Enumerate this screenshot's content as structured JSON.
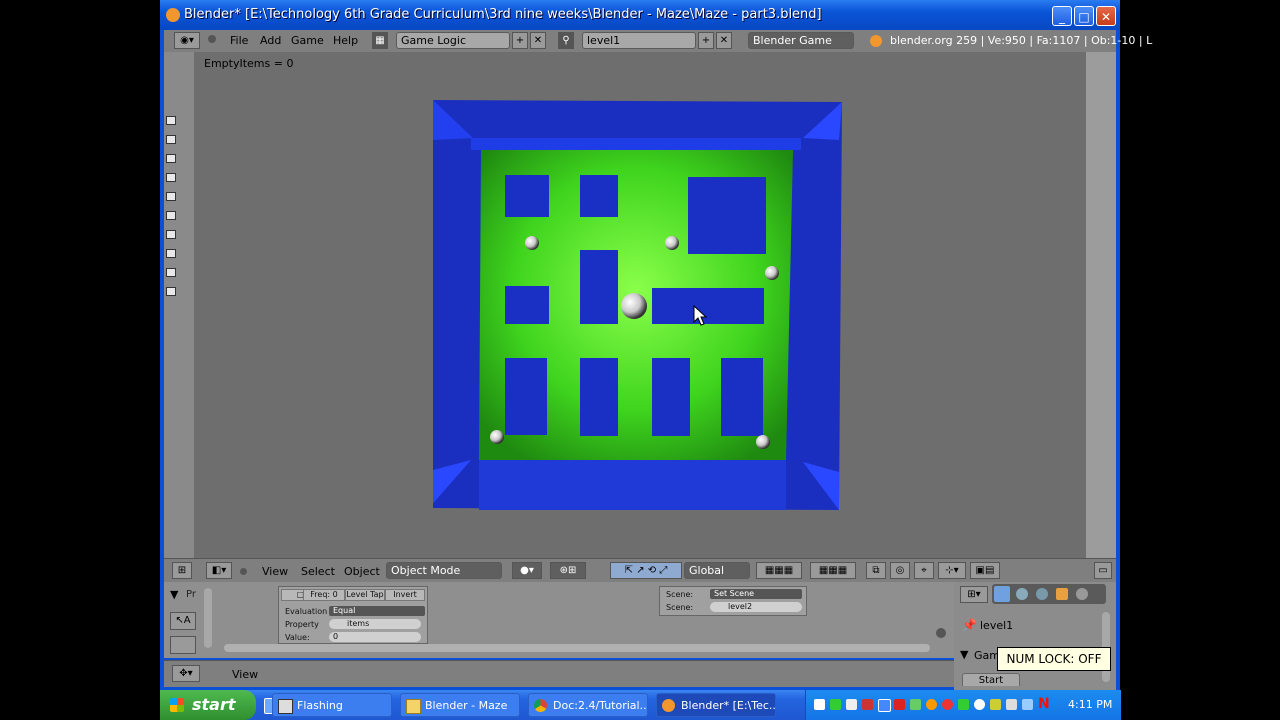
{
  "window": {
    "title": "Blender* [E:\\Technology 6th Grade Curriculum\\3rd nine weeks\\Blender - Maze\\Maze - part3.blend]",
    "minimize": "_",
    "maximize": "□",
    "close": "✕"
  },
  "header": {
    "menus": [
      "File",
      "Add",
      "Game",
      "Help"
    ],
    "screen_layout": "Game Logic",
    "scene": "level1",
    "engine": "Blender Game",
    "stats": "blender.org 259 | Ve:950 | Fa:1107 | Ob:1-10 | L"
  },
  "viewport": {
    "debug_text": "EmptyItems = 0"
  },
  "view_header": {
    "menus": [
      "View",
      "Select",
      "Object"
    ],
    "mode": "Object Mode",
    "orientation": "Global"
  },
  "logic": {
    "freq": "Freq: 0",
    "level_tap": "Level Tap",
    "invert": "Invert",
    "evaluation_label": "Evaluation T",
    "evaluation_value": "Equal",
    "property_label": "Property",
    "property_value": "items",
    "value_label": "Value:",
    "value_value": "0",
    "scene_label": "Scene:",
    "scene_action": "Set Scene",
    "scene_label2": "Scene:",
    "scene_value": "level2"
  },
  "props_panel": {
    "object_name": "level1",
    "section": "Gam",
    "start_button": "Start",
    "left_collapse": "Pr"
  },
  "bottom": {
    "view_menu": "View"
  },
  "numlock": "NUM LOCK: OFF",
  "taskbar": {
    "start": "start",
    "tasks": [
      {
        "label": "Flashing",
        "active": false
      },
      {
        "label": "Blender - Maze",
        "active": false
      },
      {
        "label": "Doc:2.4/Tutorial...",
        "active": false
      },
      {
        "label": "Blender* [E:\\Tec...",
        "active": true
      }
    ],
    "clock": "4:11 PM"
  }
}
